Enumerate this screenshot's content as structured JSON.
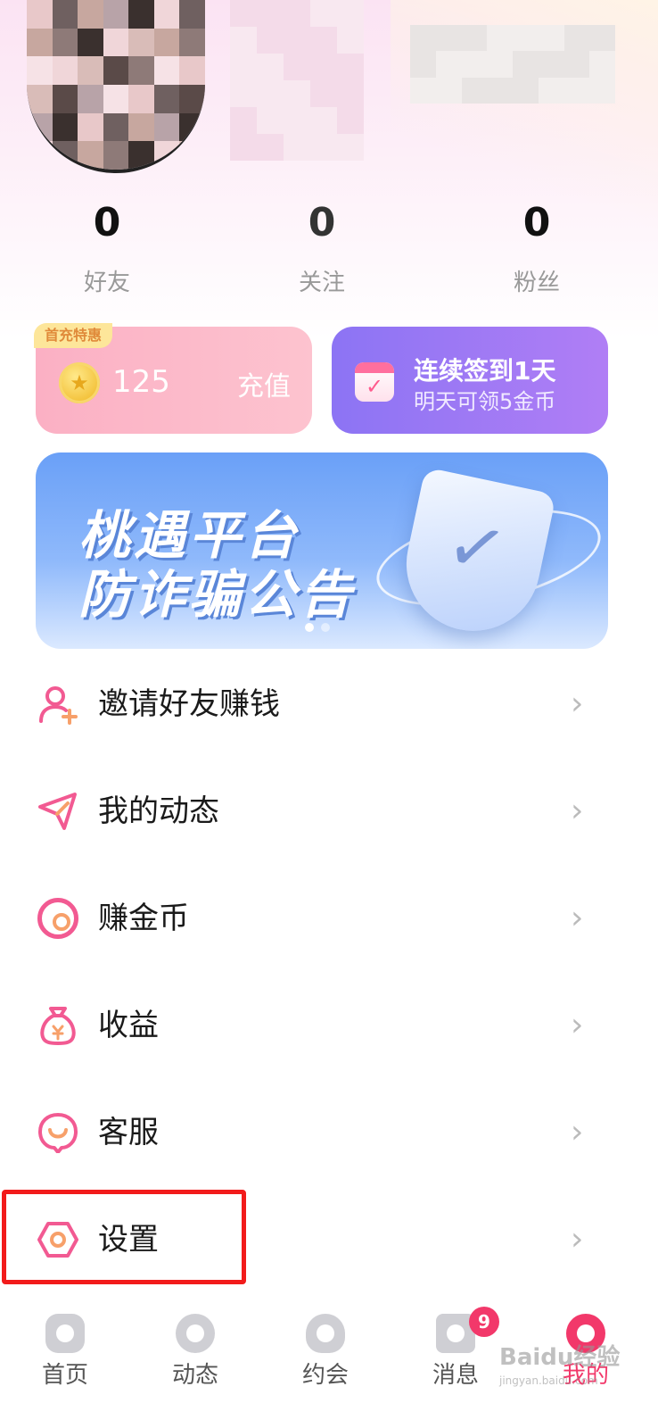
{
  "stats": [
    {
      "value": "0",
      "label": "好友"
    },
    {
      "value": "0",
      "label": "关注"
    },
    {
      "value": "0",
      "label": "粉丝"
    }
  ],
  "recharge": {
    "tag": "首充特惠",
    "coins": "125",
    "button": "充值"
  },
  "signin": {
    "title": "连续签到1天",
    "subtitle": "明天可领5金币"
  },
  "banner": {
    "line1": "桃遇平台",
    "line2": "防诈骗公告"
  },
  "menu": [
    {
      "label": "邀请好友赚钱",
      "icon": "invite-user-icon"
    },
    {
      "label": "我的动态",
      "icon": "paper-plane-icon"
    },
    {
      "label": "赚金币",
      "icon": "coin-ring-icon"
    },
    {
      "label": "收益",
      "icon": "money-bag-icon"
    },
    {
      "label": "客服",
      "icon": "customer-service-icon"
    },
    {
      "label": "设置",
      "icon": "settings-hexagon-icon"
    }
  ],
  "chevron": "›",
  "tabs": [
    {
      "label": "首页",
      "icon": "home-icon"
    },
    {
      "label": "动态",
      "icon": "compass-icon"
    },
    {
      "label": "约会",
      "icon": "heart-icon"
    },
    {
      "label": "消息",
      "icon": "message-icon",
      "badge": "9"
    },
    {
      "label": "我的",
      "icon": "profile-icon"
    }
  ],
  "watermark": {
    "text": "Baidu经验",
    "sub": "jingyan.baidu.com"
  },
  "colors": {
    "accent": "#f25a92",
    "highlight": "#f21b1b",
    "active_tab": "#f2386a"
  }
}
